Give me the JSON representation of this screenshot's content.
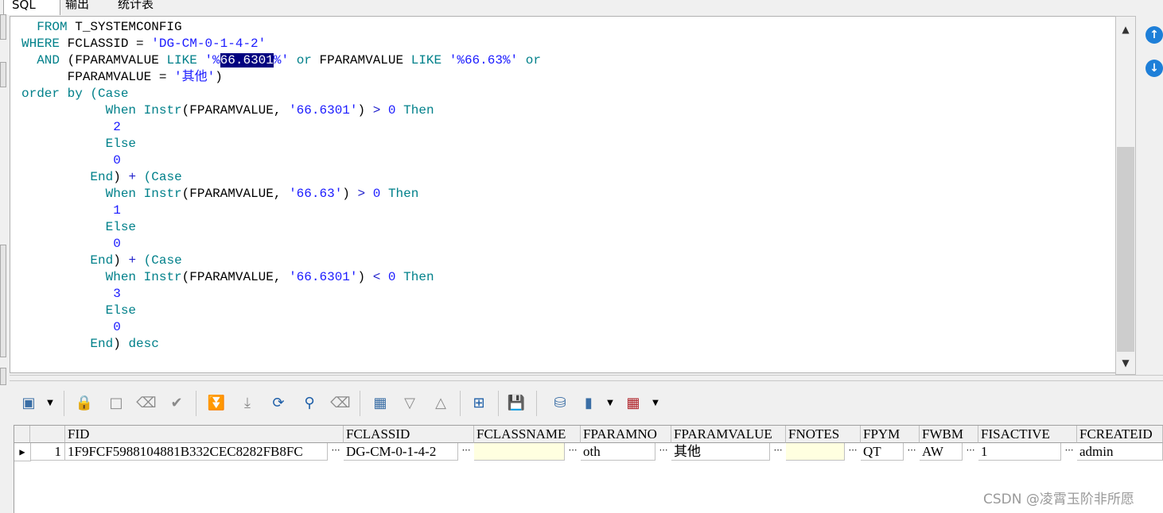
{
  "tabs": [
    {
      "label": "SQL"
    },
    {
      "label": "输出"
    },
    {
      "label": "统计表"
    }
  ],
  "editor": {
    "sql_lines": [
      [
        {
          "t": "  "
        },
        {
          "t": "FROM",
          "c": "kw"
        },
        {
          "t": " T_SYSTEMCONFIG"
        }
      ],
      [
        {
          "t": "WHERE",
          "c": "kw"
        },
        {
          "t": " FCLASSID = "
        },
        {
          "t": "'DG-CM-0-1-4-2'",
          "c": "str"
        }
      ],
      [
        {
          "t": "  "
        },
        {
          "t": "AND",
          "c": "kw"
        },
        {
          "t": " (FPARAMVALUE "
        },
        {
          "t": "LIKE",
          "c": "kw"
        },
        {
          "t": " "
        },
        {
          "t": "'%",
          "c": "str"
        },
        {
          "t": "66.6301",
          "c": "sel"
        },
        {
          "t": "%'",
          "c": "str"
        },
        {
          "t": " "
        },
        {
          "t": "or",
          "c": "kw"
        },
        {
          "t": " FPARAMVALUE "
        },
        {
          "t": "LIKE",
          "c": "kw"
        },
        {
          "t": " "
        },
        {
          "t": "'%66.63%'",
          "c": "str"
        },
        {
          "t": " "
        },
        {
          "t": "or",
          "c": "kw"
        }
      ],
      [
        {
          "t": "      FPARAMVALUE = "
        },
        {
          "t": "'其他'",
          "c": "str"
        },
        {
          "t": ")"
        }
      ],
      [
        {
          "t": "order by",
          "c": "kw"
        },
        {
          "t": " "
        },
        {
          "t": "(Case",
          "c": "kw"
        }
      ],
      [
        {
          "t": "           "
        },
        {
          "t": "When",
          "c": "kw"
        },
        {
          "t": " "
        },
        {
          "t": "Instr",
          "c": "kw"
        },
        {
          "t": "(FPARAMVALUE, "
        },
        {
          "t": "'66.6301'",
          "c": "str"
        },
        {
          "t": ") "
        },
        {
          "t": ">",
          "c": "op"
        },
        {
          "t": " "
        },
        {
          "t": "0",
          "c": "str"
        },
        {
          "t": " "
        },
        {
          "t": "Then",
          "c": "kw"
        }
      ],
      [
        {
          "t": "            "
        },
        {
          "t": "2",
          "c": "str"
        }
      ],
      [
        {
          "t": "           "
        },
        {
          "t": "Else",
          "c": "kw"
        }
      ],
      [
        {
          "t": "            "
        },
        {
          "t": "0",
          "c": "str"
        }
      ],
      [
        {
          "t": "         "
        },
        {
          "t": "End",
          "c": "kw"
        },
        {
          "t": ") "
        },
        {
          "t": "+",
          "c": "op"
        },
        {
          "t": " "
        },
        {
          "t": "(Case",
          "c": "kw"
        }
      ],
      [
        {
          "t": "           "
        },
        {
          "t": "When",
          "c": "kw"
        },
        {
          "t": " "
        },
        {
          "t": "Instr",
          "c": "kw"
        },
        {
          "t": "(FPARAMVALUE, "
        },
        {
          "t": "'66.63'",
          "c": "str"
        },
        {
          "t": ") "
        },
        {
          "t": ">",
          "c": "op"
        },
        {
          "t": " "
        },
        {
          "t": "0",
          "c": "str"
        },
        {
          "t": " "
        },
        {
          "t": "Then",
          "c": "kw"
        }
      ],
      [
        {
          "t": "            "
        },
        {
          "t": "1",
          "c": "str"
        }
      ],
      [
        {
          "t": "           "
        },
        {
          "t": "Else",
          "c": "kw"
        }
      ],
      [
        {
          "t": "            "
        },
        {
          "t": "0",
          "c": "str"
        }
      ],
      [
        {
          "t": "         "
        },
        {
          "t": "End",
          "c": "kw"
        },
        {
          "t": ") "
        },
        {
          "t": "+",
          "c": "op"
        },
        {
          "t": " "
        },
        {
          "t": "(Case",
          "c": "kw"
        }
      ],
      [
        {
          "t": "           "
        },
        {
          "t": "When",
          "c": "kw"
        },
        {
          "t": " "
        },
        {
          "t": "Instr",
          "c": "kw"
        },
        {
          "t": "(FPARAMVALUE, "
        },
        {
          "t": "'66.6301'",
          "c": "str"
        },
        {
          "t": ") "
        },
        {
          "t": "<",
          "c": "op"
        },
        {
          "t": " "
        },
        {
          "t": "0",
          "c": "str"
        },
        {
          "t": " "
        },
        {
          "t": "Then",
          "c": "kw"
        }
      ],
      [
        {
          "t": "            "
        },
        {
          "t": "3",
          "c": "str"
        }
      ],
      [
        {
          "t": "           "
        },
        {
          "t": "Else",
          "c": "kw"
        }
      ],
      [
        {
          "t": "            "
        },
        {
          "t": "0",
          "c": "str"
        }
      ],
      [
        {
          "t": "         "
        },
        {
          "t": "End",
          "c": "kw"
        },
        {
          "t": ") "
        },
        {
          "t": "desc",
          "c": "kw"
        }
      ]
    ]
  },
  "toolbar": {
    "icons": [
      "select-grid-icon",
      "dropdown-arrow-icon",
      "lock-icon",
      "insert-record-icon",
      "delete-record-icon",
      "post-record-icon",
      "fetch-next-page-icon",
      "fetch-all-icon",
      "refresh-icon",
      "find-icon",
      "clear-icon",
      "save-results-icon",
      "previous-record-icon",
      "next-record-icon",
      "tree-view-icon",
      "save-icon",
      "export-icon",
      "chart-icon",
      "dropdown-arrow-icon",
      "table-icon",
      "dropdown-arrow-icon"
    ]
  },
  "grid": {
    "columns": [
      "FID",
      "FCLASSID",
      "FCLASSNAME",
      "FPARAMNO",
      "FPARAMVALUE",
      "FNOTES",
      "FPYM",
      "FWBM",
      "FISACTIVE",
      "FCREATEID"
    ],
    "rows": [
      {
        "num": "1",
        "cells": [
          "1F9FCF5988104881B332CEC8282FB8FC",
          "DG-CM-0-1-4-2",
          "",
          "oth",
          "其他",
          "",
          "QT",
          "AW",
          "1",
          "admin"
        ]
      }
    ]
  },
  "watermark": "CSDN @凌霄玉阶非所愿",
  "colors": {
    "keyword": "#00808a",
    "string": "#1a1aff",
    "selection": "#000080",
    "nav_button": "#1e7fd8"
  }
}
